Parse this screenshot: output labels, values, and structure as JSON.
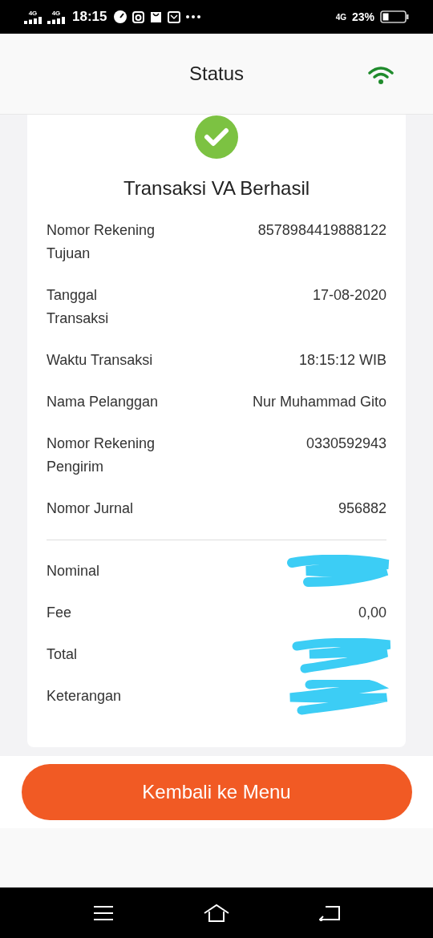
{
  "status_bar": {
    "signals": [
      "4G",
      "4G"
    ],
    "time": "18:15",
    "network": "4G",
    "battery": "23%"
  },
  "header": {
    "title": "Status"
  },
  "result": {
    "title": "Transaksi VA Berhasil"
  },
  "details": [
    {
      "kind": "text",
      "label": "Nomor Rekening\nTujuan",
      "value": "8578984419888122"
    },
    {
      "kind": "text",
      "label": "Tanggal\nTransaksi",
      "value": "17-08-2020"
    },
    {
      "kind": "text",
      "label": "Waktu Transaksi",
      "value": "18:15:12 WIB"
    },
    {
      "kind": "text",
      "label": "Nama Pelanggan",
      "value": "Nur Muhammad Gito"
    },
    {
      "kind": "text",
      "label": "Nomor Rekening\nPengirim",
      "value": "0330592943"
    },
    {
      "kind": "text",
      "label": "Nomor Jurnal",
      "value": "956882"
    }
  ],
  "amounts": [
    {
      "kind": "redacted",
      "label": "Nominal"
    },
    {
      "kind": "text",
      "label": "Fee",
      "value": "0,00"
    },
    {
      "kind": "redacted",
      "label": "Total"
    },
    {
      "kind": "redacted",
      "label": "Keterangan"
    }
  ],
  "button": {
    "label": "Kembali ke Menu"
  }
}
